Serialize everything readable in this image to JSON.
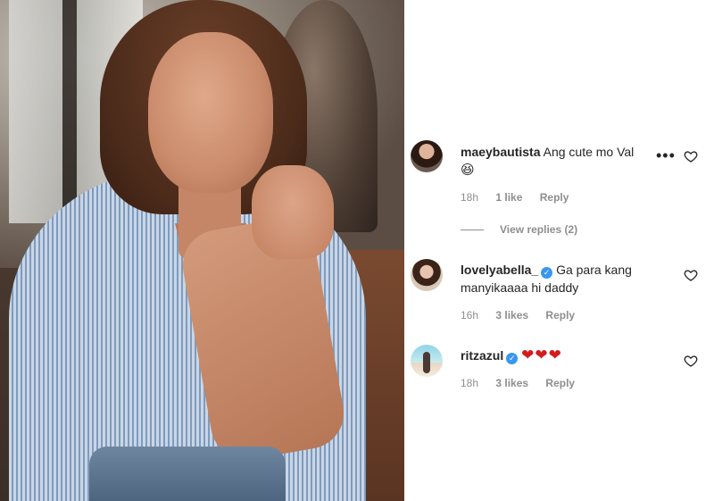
{
  "comments": [
    {
      "username": "maeybautista",
      "verified": false,
      "text": "Ang cute mo Val",
      "emoji": "😆",
      "time": "18h",
      "likes": "1 like",
      "reply": "Reply",
      "more": "•••"
    },
    {
      "username": "lovelyabella_",
      "verified": true,
      "text": "Ga para kang manyikaaaa hi daddy",
      "time": "16h",
      "likes": "3 likes",
      "reply": "Reply"
    },
    {
      "username": "ritzazul",
      "verified": true,
      "hearts": "❤❤❤",
      "time": "18h",
      "likes": "3 likes",
      "reply": "Reply"
    }
  ],
  "view_replies": "View replies (2)",
  "icons": {
    "like": "heart-outline-icon",
    "verified": "verified-badge-icon",
    "more": "more-options-icon"
  },
  "colors": {
    "text": "#262626",
    "meta": "#8e8e8e",
    "verified": "#3897f0",
    "heart_emoji": "#d21c1c"
  }
}
